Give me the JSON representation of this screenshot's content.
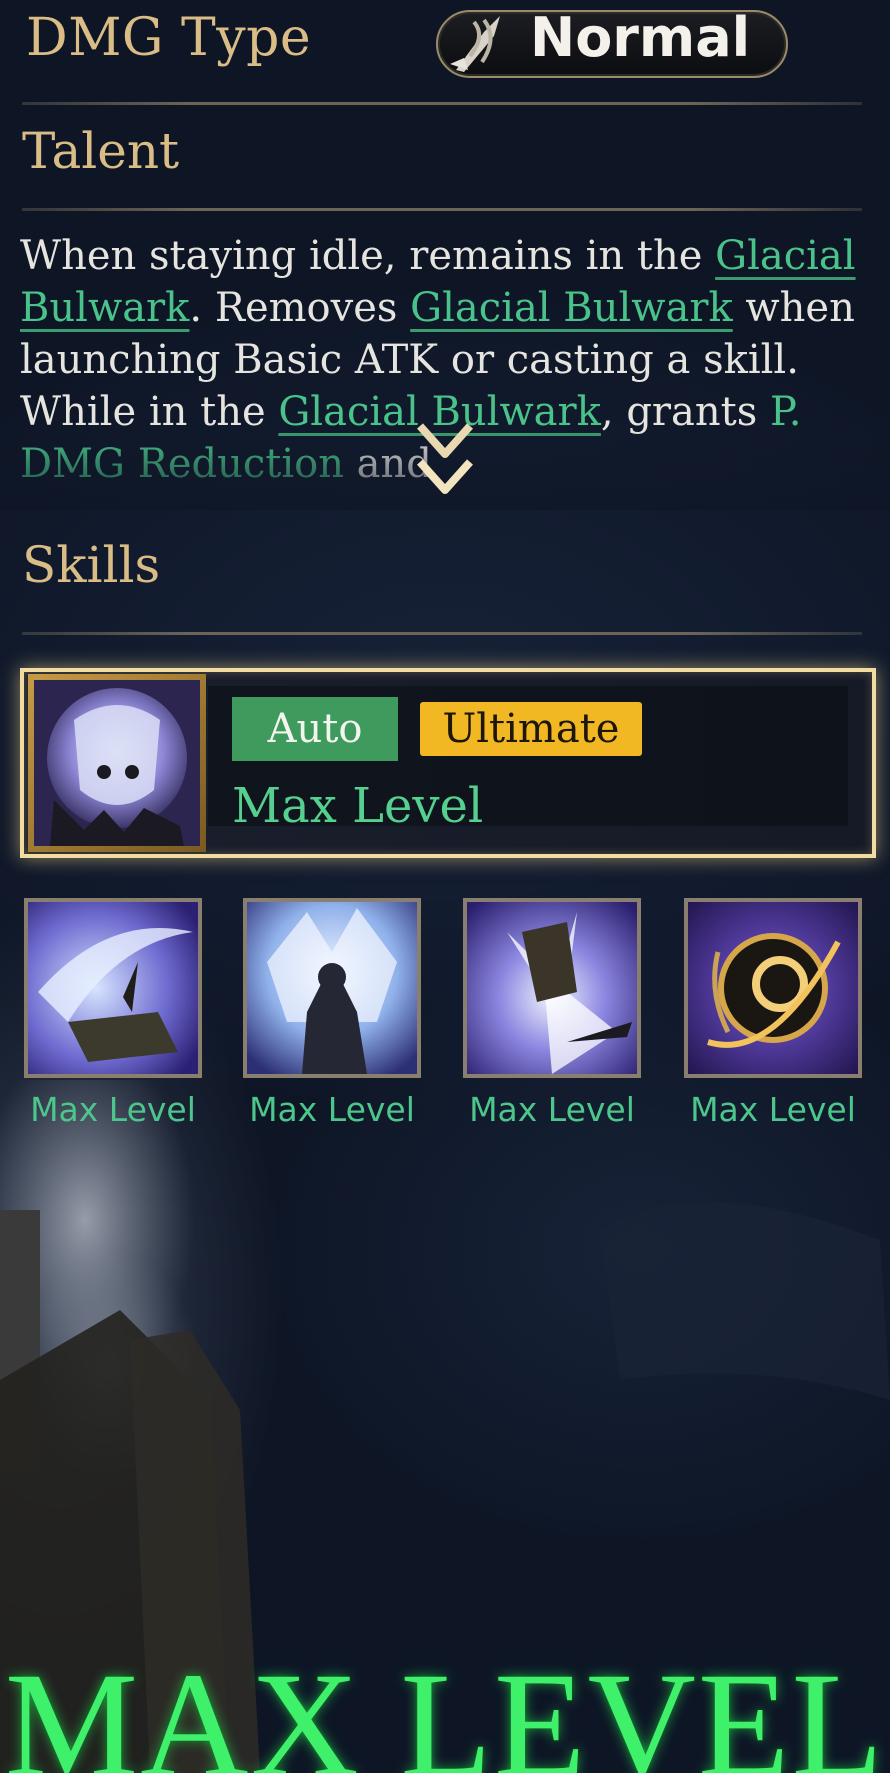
{
  "header": {
    "dmg_type_label": "DMG Type",
    "dmg_type_value": "Normal",
    "dmg_icon": "sword-icon"
  },
  "talent": {
    "title": "Talent",
    "segments": [
      {
        "t": "When staying idle, remains in the "
      },
      {
        "t": "Glacial Bulwark",
        "kw": true,
        "ul": true
      },
      {
        "t": ". Removes "
      },
      {
        "t": "Glacial Bulwark",
        "kw": true,
        "ul": true
      },
      {
        "t": " when launching Basic ATK or casting a skill. While in the "
      },
      {
        "t": "Glacial Bulwark",
        "kw": true,
        "ul": true
      },
      {
        "t": ", grants "
      },
      {
        "t": "P. DMG Reduction",
        "kw": true
      },
      {
        "t": " and"
      }
    ],
    "expand_icon": "chevron-down-icon"
  },
  "skills": {
    "title": "Skills",
    "main": {
      "tags": [
        "Auto",
        "Ultimate"
      ],
      "level": "Max Level",
      "icon": "shield-orb-icon"
    },
    "others": [
      {
        "level": "Max Level",
        "icon": "ice-slash-icon"
      },
      {
        "level": "Max Level",
        "icon": "ice-burst-icon"
      },
      {
        "level": "Max Level",
        "icon": "shatter-strike-icon"
      },
      {
        "level": "Max Level",
        "icon": "golden-orb-icon"
      }
    ]
  },
  "banner": {
    "text": "MAX LEVEL"
  },
  "colors": {
    "gold": "#d9bc86",
    "keyword": "#4ac38b",
    "level": "#55d08f",
    "banner": "#3ff06a",
    "ultimate_tag": "#f1b824",
    "auto_tag": "#3f9a5d"
  }
}
